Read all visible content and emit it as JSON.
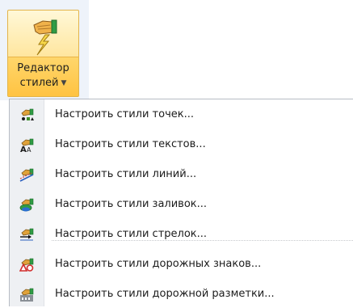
{
  "ribbon": {
    "button_line1": "Редактор",
    "button_line2": "стилей",
    "button_icon": "hand-lightning-icon",
    "dropdown_icon": "chevron-down-icon"
  },
  "menu": {
    "items": [
      {
        "label": "Настроить стили точек...",
        "icon": "point-styles-icon"
      },
      {
        "label": "Настроить стили текстов...",
        "icon": "text-styles-icon"
      },
      {
        "label": "Настроить стили линий...",
        "icon": "line-styles-icon"
      },
      {
        "label": "Настроить стили заливок...",
        "icon": "fill-styles-icon"
      },
      {
        "label": "Настроить стили стрелок...",
        "icon": "arrow-styles-icon"
      },
      {
        "label": "Настроить стили дорожных знаков...",
        "icon": "road-sign-styles-icon"
      },
      {
        "label": "Настроить стили дорожной разметки...",
        "icon": "road-marking-styles-icon"
      }
    ]
  },
  "colors": {
    "accent": "#ffc342",
    "border": "#e3b44a",
    "gutter": "#eef0f3"
  }
}
